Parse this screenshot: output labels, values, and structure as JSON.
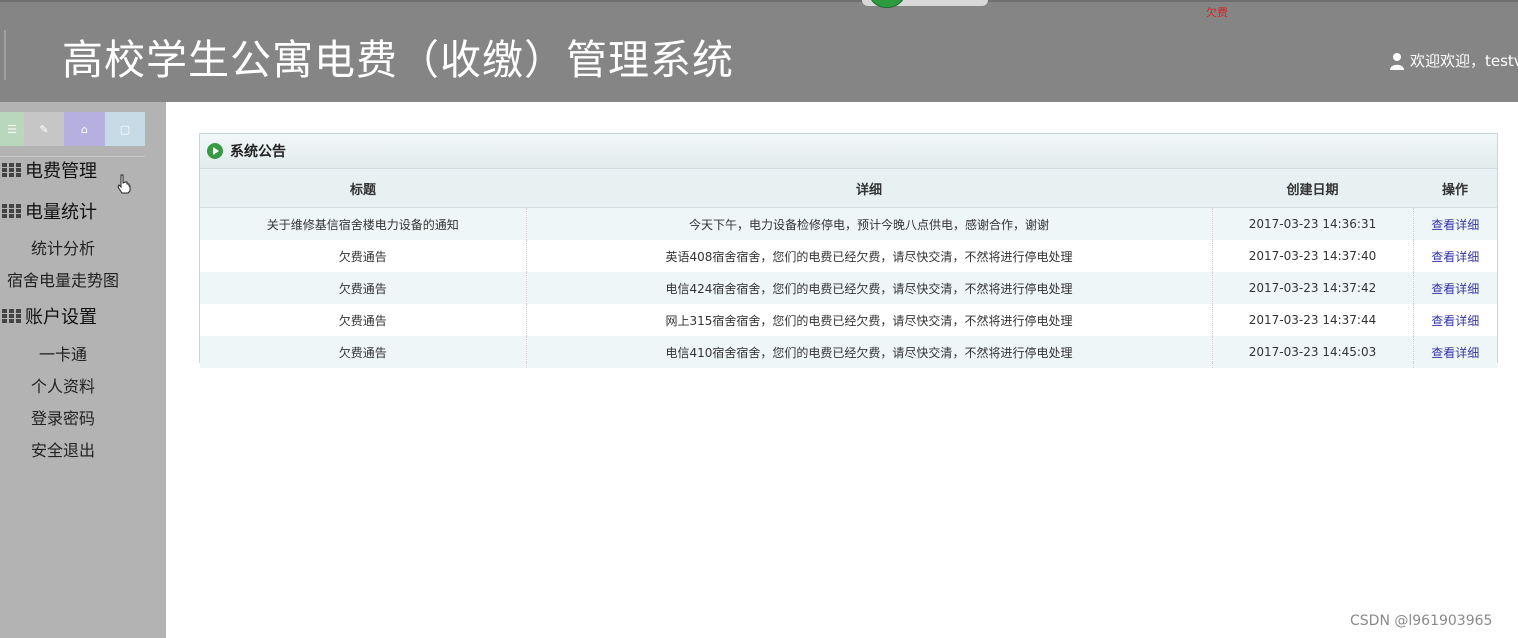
{
  "header": {
    "title": "高校学生公寓电费（收缴）管理系统",
    "welcome": "欢迎欢迎，testv",
    "red_mark": "欠费"
  },
  "sidebar": {
    "sections": [
      {
        "label": "电费管理",
        "items": []
      },
      {
        "label": "电量统计",
        "items": [
          "统计分析",
          "宿舍电量走势图"
        ]
      },
      {
        "label": "账户设置",
        "items": [
          "一卡通",
          "个人资料",
          "登录密码",
          "安全退出"
        ]
      }
    ]
  },
  "notice": {
    "title": "系统公告",
    "columns": [
      "标题",
      "详细",
      "创建日期",
      "操作"
    ],
    "rows": [
      {
        "title": "关于维修基信宿舍楼电力设备的通知",
        "detail": "今天下午，电力设备检修停电，预计今晚八点供电，感谢合作，谢谢",
        "date": "2017-03-23 14:36:31",
        "action": "查看详细"
      },
      {
        "title": "欠费通告",
        "detail": "英语408宿舍宿舍，您们的电费已经欠费，请尽快交清，不然将进行停电处理",
        "date": "2017-03-23 14:37:40",
        "action": "查看详细"
      },
      {
        "title": "欠费通告",
        "detail": "电信424宿舍宿舍，您们的电费已经欠费，请尽快交清，不然将进行停电处理",
        "date": "2017-03-23 14:37:42",
        "action": "查看详细"
      },
      {
        "title": "欠费通告",
        "detail": "网上315宿舍宿舍，您们的电费已经欠费，请尽快交清，不然将进行停电处理",
        "date": "2017-03-23 14:37:44",
        "action": "查看详细"
      },
      {
        "title": "欠费通告",
        "detail": "电信410宿舍宿舍，您们的电费已经欠费，请尽快交清，不然将进行停电处理",
        "date": "2017-03-23 14:45:03",
        "action": "查看详细"
      }
    ]
  },
  "watermark": "CSDN @l961903965",
  "colors": {
    "header_bg": "#858585",
    "sidebar_bg": "#b3b3b3",
    "link": "#3434a8",
    "row_alt": "#eef6f7"
  }
}
